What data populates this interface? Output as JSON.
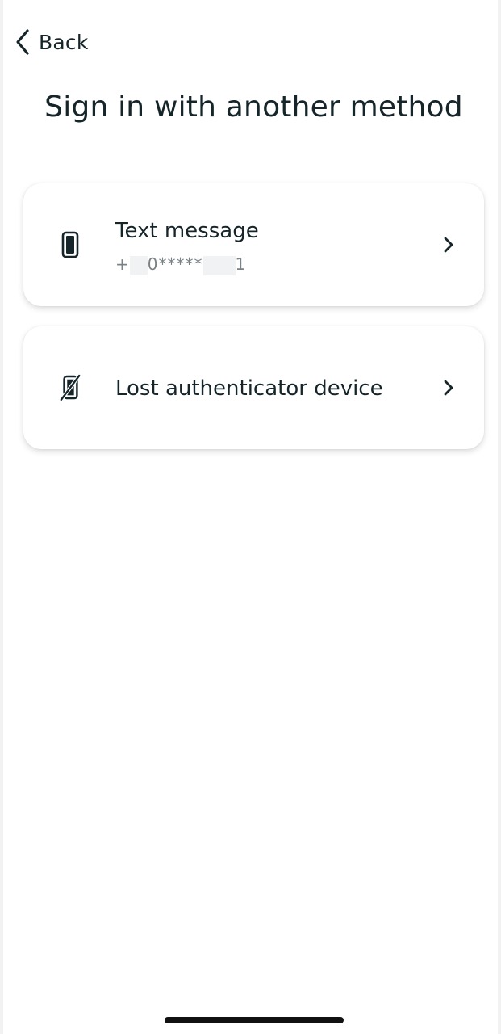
{
  "header": {
    "back_label": "Back",
    "title": "Sign in with another method"
  },
  "methods": [
    {
      "title": "Text message",
      "subtitle_prefix": "+",
      "subtitle_masked": "0*****",
      "subtitle_suffix": "1",
      "icon": "phone-icon"
    },
    {
      "title": "Lost authenticator device",
      "icon": "phone-off-icon"
    }
  ],
  "colors": {
    "text": "#15252a",
    "subtitle": "#7b8286",
    "card_bg": "#ffffff"
  }
}
